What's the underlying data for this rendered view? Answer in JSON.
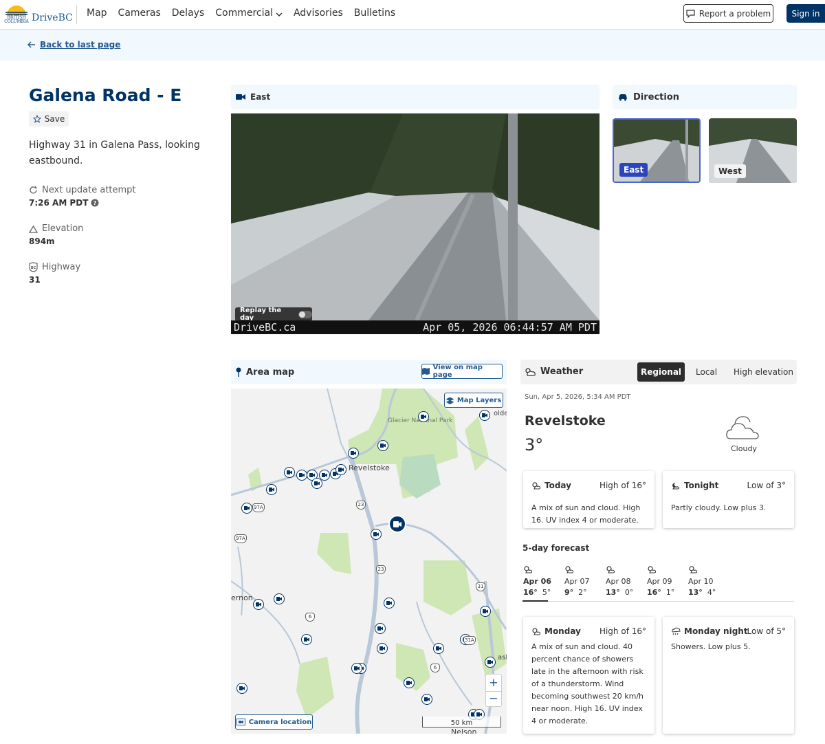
{
  "header": {
    "logo_text": "DriveBC",
    "logo_sub": "BRITISH COLUMBIA",
    "nav": [
      "Map",
      "Cameras",
      "Delays",
      "Commercial",
      "Advisories",
      "Bulletins"
    ],
    "report_label": "Report a problem",
    "signin_label": "Sign in"
  },
  "back_label": "Back to last page",
  "camera": {
    "name": "Galena Road - E",
    "save_label": "Save",
    "description": "Highway 31 in Galena Pass, looking eastbound.",
    "next_update_label": "Next update attempt",
    "next_update_value": "7:26 AM PDT",
    "elevation_label": "Elevation",
    "elevation_value": "894m",
    "highway_label": "Highway",
    "highway_value": "31"
  },
  "viewer": {
    "direction": "East",
    "replay_label": "Replay the day",
    "watermark_left": "DriveBC.ca",
    "watermark_right": "Apr 05, 2026 06:44:57 AM PDT"
  },
  "direction_panel": {
    "title": "Direction",
    "east": "East",
    "west": "West"
  },
  "area_map": {
    "title": "Area map",
    "view_label": "View on map page",
    "layers_label": "Map Layers",
    "camera_location_label": "Camera location",
    "scale_label": "50 km",
    "places": {
      "revelstoke": "Revelstoke",
      "glacier": "Glacier National Park",
      "vernon": "ernon",
      "nelson": "Nelson",
      "golden": "olde",
      "castlegar": "asl"
    },
    "shields": {
      "h23a": "23",
      "h23b": "23",
      "h31": "31",
      "h6a": "6",
      "h6b": "6",
      "h31a": "31A",
      "h97a": "97A",
      "h97b": "97A"
    }
  },
  "weather": {
    "title": "Weather",
    "tabs": [
      "Regional",
      "Local",
      "High elevation"
    ],
    "timestamp": "Sun, Apr 5, 2026, 5:34 AM PDT",
    "location": "Revelstoke",
    "temp": "3°",
    "condition": "Cloudy",
    "today": {
      "label": "Today",
      "hi": "High of 16°",
      "text": "A mix of sun and cloud. High 16. UV index 4 or moderate."
    },
    "tonight": {
      "label": "Tonight",
      "lo": "Low of 3°",
      "text": "Partly cloudy. Low plus 3."
    },
    "forecast_title": "5-day forecast",
    "forecast": [
      {
        "d": "Apr 06",
        "hi": "16°",
        "lo": "5°"
      },
      {
        "d": "Apr 07",
        "hi": "9°",
        "lo": "2°"
      },
      {
        "d": "Apr 08",
        "hi": "13°",
        "lo": "0°"
      },
      {
        "d": "Apr 09",
        "hi": "16°",
        "lo": "1°"
      },
      {
        "d": "Apr 10",
        "hi": "13°",
        "lo": "4°"
      }
    ],
    "monday": {
      "label": "Monday",
      "hi": "High of 16°",
      "text": "A mix of sun and cloud. 40 percent chance of showers late in the afternoon with risk of a thunderstorm. Wind becoming southwest 20 km/h near noon. High 16. UV index 4 or moderate."
    },
    "monday_night": {
      "label": "Monday night",
      "lo": "Low of 5°",
      "text": "Showers. Low plus 5."
    }
  },
  "colors": {
    "brand": "#013366",
    "accent": "#255a90",
    "park": "#cfe6b5",
    "water": "#b8c8d8"
  }
}
